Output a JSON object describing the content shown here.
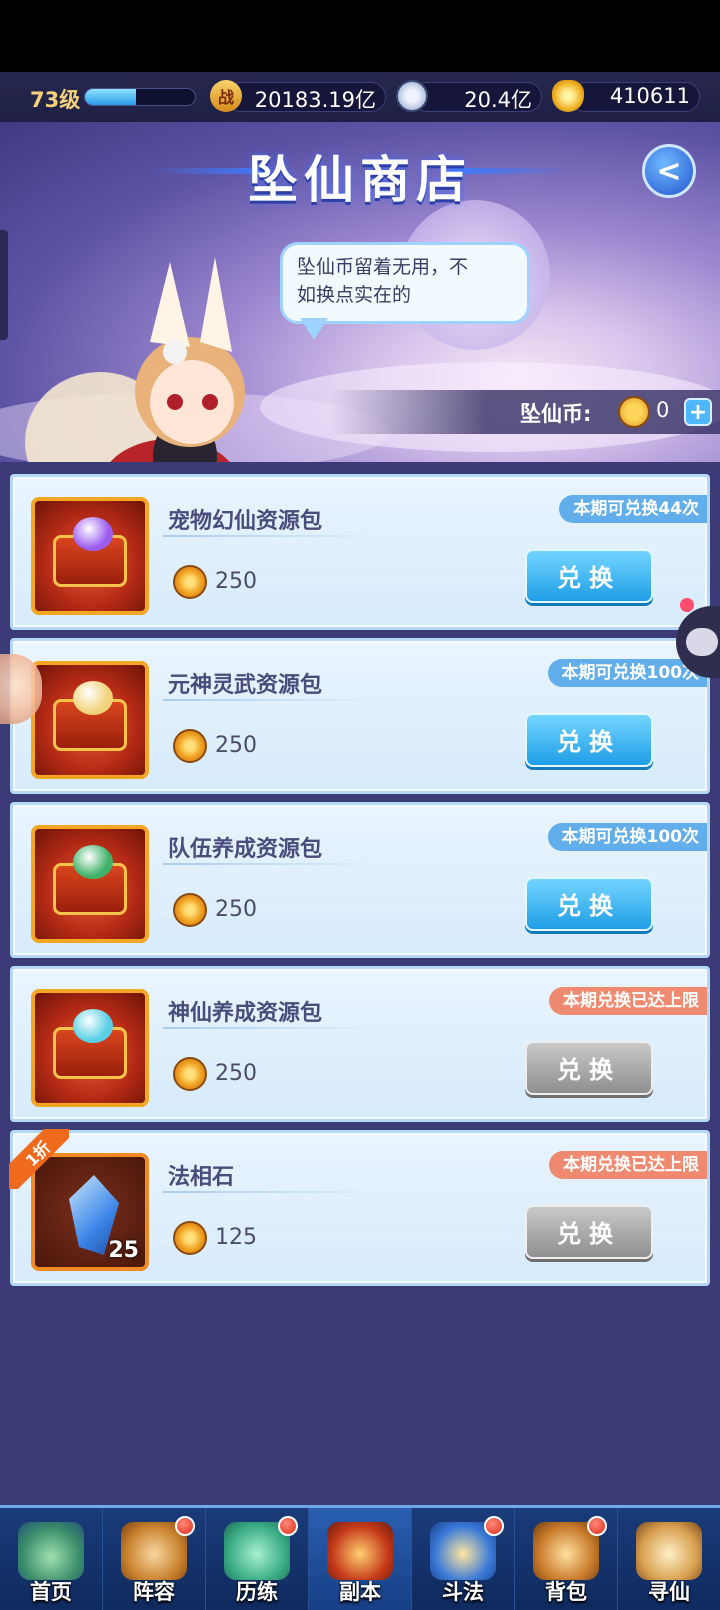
{
  "topbar": {
    "level": "73级",
    "xp_fraction": 0.46,
    "combat_icon": "战",
    "combat_power": "20183.19亿",
    "silver": "20.4亿",
    "gold": "410611"
  },
  "banner": {
    "title": "坠仙商店",
    "back_icon": "<",
    "bubble_text_line1": "坠仙币留着无用，不",
    "bubble_text_line2": "如换点实在的",
    "currency_label": "坠仙币:",
    "currency_value": "0",
    "add_icon": "+"
  },
  "items": [
    {
      "name": "宠物幻仙资源包",
      "price": "250",
      "limit": "本期可兑换44次",
      "limit_state": "available",
      "button": "兑换",
      "button_state": "active",
      "gem_color": "#9b5cf0"
    },
    {
      "name": "元神灵武资源包",
      "price": "250",
      "limit": "本期可兑换100次",
      "limit_state": "available",
      "button": "兑换",
      "button_state": "active",
      "gem_color": "#f2d27a"
    },
    {
      "name": "队伍养成资源包",
      "price": "250",
      "limit": "本期可兑换100次",
      "limit_state": "available",
      "button": "兑换",
      "button_state": "active",
      "gem_color": "#3fb26a"
    },
    {
      "name": "神仙养成资源包",
      "price": "250",
      "limit": "本期兑换已达上限",
      "limit_state": "maxed",
      "button": "兑换",
      "button_state": "disabled",
      "gem_color": "#5ad0e6"
    },
    {
      "name": "法相石",
      "price": "125",
      "limit": "本期兑换已达上限",
      "limit_state": "maxed",
      "button": "兑换",
      "button_state": "disabled",
      "discount": "1折",
      "quantity": "25"
    }
  ],
  "nav": [
    {
      "label": "首页",
      "icon": "home-icon",
      "badge": false
    },
    {
      "label": "阵容",
      "icon": "lineup-icon",
      "badge": true
    },
    {
      "label": "历练",
      "icon": "training-icon",
      "badge": true
    },
    {
      "label": "副本",
      "icon": "dungeon-icon",
      "badge": false
    },
    {
      "label": "斗法",
      "icon": "battle-icon",
      "badge": true
    },
    {
      "label": "背包",
      "icon": "bag-icon",
      "badge": true
    },
    {
      "label": "寻仙",
      "icon": "seek-immortal-icon",
      "badge": false
    }
  ],
  "colors": {
    "accent_blue": "#1f9ee6",
    "limit_blue": "#62aeea",
    "limit_red": "#ef8a70",
    "gold": "#f0a020"
  }
}
